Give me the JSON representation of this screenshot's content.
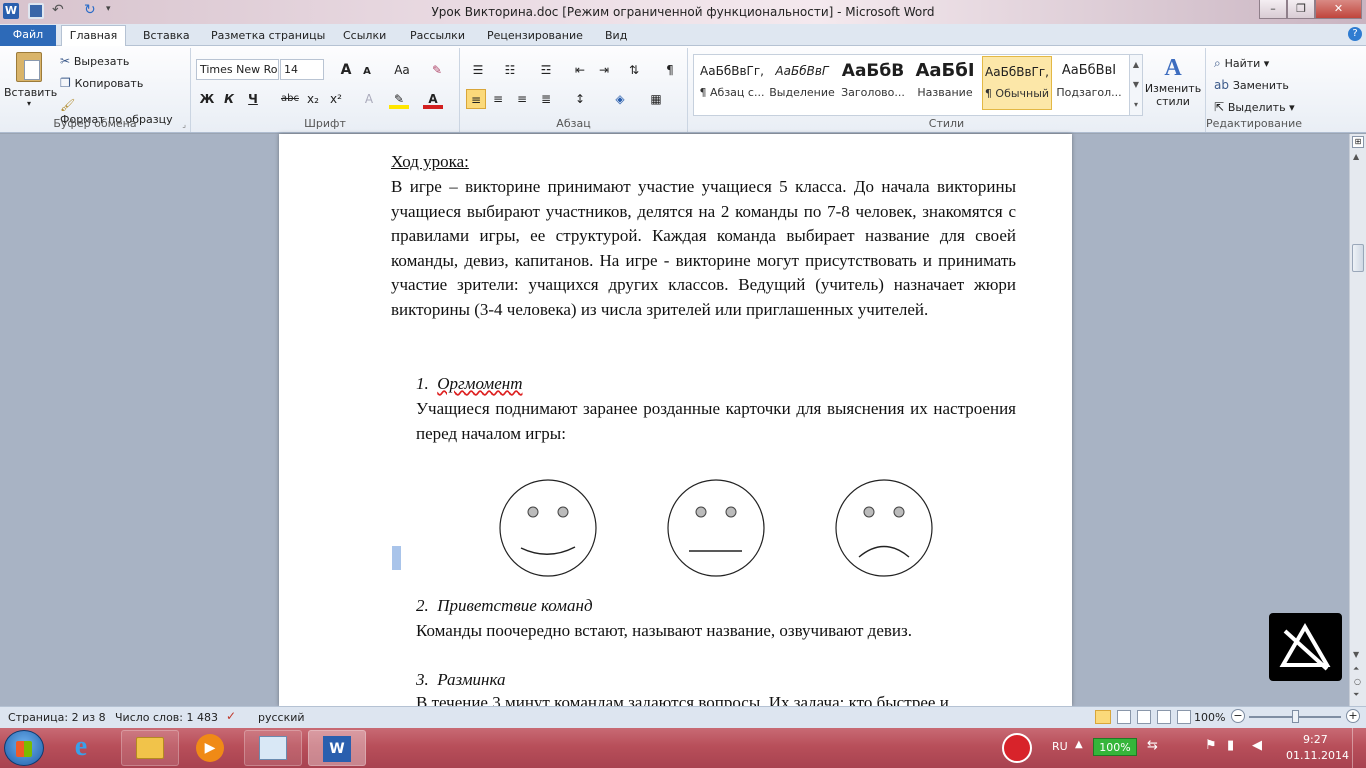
{
  "window": {
    "title": "Урок Викторина.doc [Режим ограниченной функциональности]  -  Microsoft Word",
    "controls": {
      "minimize": "–",
      "maximize": "❐",
      "close": "✕"
    }
  },
  "tabs": [
    "Файл",
    "Главная",
    "Вставка",
    "Разметка страницы",
    "Ссылки",
    "Рассылки",
    "Рецензирование",
    "Вид"
  ],
  "clipboard": {
    "paste": "Вставить",
    "cut": "Вырезать",
    "copy": "Копировать",
    "format_painter": "Формат по образцу",
    "label": "Буфер обмена"
  },
  "font": {
    "name": "Times New Ro",
    "size": "14",
    "grow": "A",
    "shrink": "A",
    "case": "Aa",
    "bold": "Ж",
    "italic": "К",
    "underline": "Ч",
    "strike": "abc",
    "subscript": "x₂",
    "superscript": "x²",
    "label": "Шрифт"
  },
  "paragraph": {
    "label": "Абзац",
    "pilcrow": "¶"
  },
  "styles": {
    "items": [
      {
        "preview": "АаБбВвГг,",
        "name": "¶ Абзац с..."
      },
      {
        "preview": "АаБбВвГ",
        "name": "Выделение"
      },
      {
        "preview": "АаБбВ",
        "name": "Заголово..."
      },
      {
        "preview": "АаБбІ",
        "name": "Название"
      },
      {
        "preview": "АаБбВвГг,",
        "name": "¶ Обычный"
      },
      {
        "preview": "АаБбВвІ",
        "name": "Подзагол..."
      }
    ],
    "change": "Изменить стили",
    "change_line1": "Изменить",
    "change_line2": "стили",
    "label": "Стили"
  },
  "editing": {
    "find": "Найти",
    "replace": "Заменить",
    "select": "Выделить",
    "label": "Редактирование"
  },
  "document": {
    "heading": "Ход урока:",
    "intro": "В игре – викторине принимают участие учащиеся 5 класса. До начала викторины учащиеся выбирают участников, делятся на 2 команды по 7-8 человек, знакомятся с правилами игры, ее структурой. Каждая команда выбирает название для своей команды, девиз, капитанов. На игре - викторине могут присутствовать и принимать участие зрители: учащихся других классов. Ведущий (учитель) назначает жюри викторины (3-4 человека) из числа зрителей или приглашенных учителей.",
    "sections": [
      {
        "num": "1.",
        "title": "Оргмомент",
        "text": "Учащиеся поднимают заранее розданные карточки для выяснения их настроения перед началом игры:"
      },
      {
        "num": "2.",
        "title": "Приветствие команд",
        "text": "Команды поочередно встают, называют название, озвучивают девиз."
      },
      {
        "num": "3.",
        "title": "Разминка",
        "text": "В течение 3 минут командам задаются вопросы. Их задача: кто быстрее и"
      }
    ],
    "faces": [
      "happy",
      "neutral",
      "sad"
    ]
  },
  "status": {
    "page": "Страница: 2 из 8",
    "words": "Число слов: 1 483",
    "language": "русский",
    "zoom": "100%"
  },
  "taskbar": {
    "lang": "RU",
    "battery": "100%",
    "time": "9:27",
    "date": "01.11.2014"
  },
  "colors": {
    "file_tab": "#2d6ab8",
    "taskbar": "#b84f5a",
    "selected_style": "#fbd97a"
  }
}
